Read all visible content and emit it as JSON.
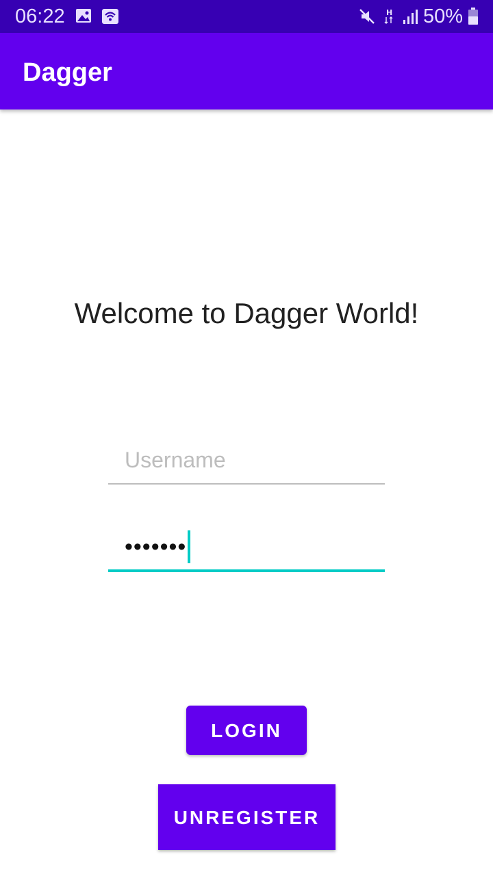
{
  "status_bar": {
    "time": "06:22",
    "battery": "50%",
    "icons": [
      "image-icon",
      "wifi-hotspot-icon",
      "mute-icon",
      "network-h-icon",
      "signal-icon",
      "battery-icon"
    ]
  },
  "app_bar": {
    "title": "Dagger"
  },
  "main": {
    "welcome": "Welcome to Dagger World!",
    "username": {
      "placeholder": "Username",
      "value": ""
    },
    "password": {
      "masked_value": "•••••••"
    },
    "login_label": "LOGIN",
    "unregister_label": "UNREGISTER"
  },
  "colors": {
    "status_bar": "#3700B3",
    "primary": "#6200EE",
    "accent": "#03CCC6"
  }
}
